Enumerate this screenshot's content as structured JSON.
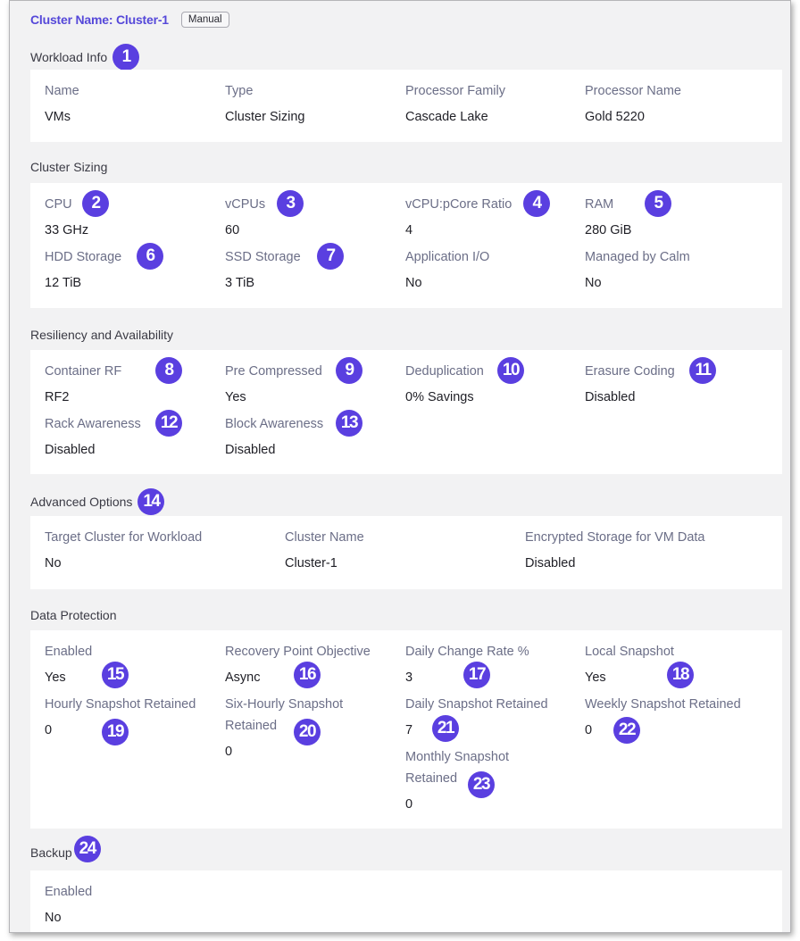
{
  "header": {
    "cluster_name": "Cluster Name: Cluster-1",
    "mode_button": "Manual"
  },
  "accent_color": "#5a3fe0",
  "sections": {
    "workload": {
      "title": "Workload Info",
      "badge": "1",
      "fields": [
        {
          "label": "Name",
          "value": "VMs"
        },
        {
          "label": "Type",
          "value": "Cluster Sizing"
        },
        {
          "label": "Processor Family",
          "value": "Cascade Lake"
        },
        {
          "label": "Processor Name",
          "value": "Gold 5220"
        }
      ]
    },
    "sizing": {
      "title": "Cluster Sizing",
      "fields": [
        {
          "label": "CPU",
          "value": "33 GHz",
          "badge": "2"
        },
        {
          "label": "vCPUs",
          "value": "60",
          "badge": "3"
        },
        {
          "label": "vCPU:pCore Ratio",
          "value": "4",
          "badge": "4"
        },
        {
          "label": "RAM",
          "value": "280 GiB",
          "badge": "5"
        },
        {
          "label": "HDD Storage",
          "value": "12 TiB",
          "badge": "6"
        },
        {
          "label": "SSD Storage",
          "value": "3 TiB",
          "badge": "7"
        },
        {
          "label": "Application I/O",
          "value": "No"
        },
        {
          "label": "Managed by Calm",
          "value": "No"
        }
      ]
    },
    "resiliency": {
      "title": "Resiliency and Availability",
      "fields": [
        {
          "label": "Container RF",
          "value": "RF2",
          "badge": "8"
        },
        {
          "label": "Pre Compressed",
          "value": "Yes",
          "badge": "9"
        },
        {
          "label": "Deduplication",
          "value": "0% Savings",
          "badge": "10"
        },
        {
          "label": "Erasure Coding",
          "value": "Disabled",
          "badge": "11"
        },
        {
          "label": "Rack Awareness",
          "value": "Disabled",
          "badge": "12"
        },
        {
          "label": "Block Awareness",
          "value": "Disabled",
          "badge": "13"
        }
      ]
    },
    "advanced": {
      "title": "Advanced Options",
      "badge": "14",
      "fields": [
        {
          "label": "Target Cluster for Workload",
          "value": "No"
        },
        {
          "label": "Cluster Name",
          "value": "Cluster-1"
        },
        {
          "label": "Encrypted Storage for VM Data",
          "value": "Disabled"
        }
      ]
    },
    "protection": {
      "title": "Data Protection",
      "fields": [
        {
          "label": "Enabled",
          "value": "Yes",
          "badge": "15"
        },
        {
          "label": "Recovery Point Objective",
          "value": "Async",
          "badge": "16"
        },
        {
          "label": "Daily Change Rate %",
          "value": "3",
          "badge": "17"
        },
        {
          "label": "Local Snapshot",
          "value": "Yes",
          "badge": "18"
        },
        {
          "label": "Hourly Snapshot Retained",
          "value": "0",
          "badge": "19"
        },
        {
          "label": "Six-Hourly Snapshot",
          "label2": "Retained",
          "value": "0",
          "badge": "20"
        },
        {
          "label": "Daily Snapshot Retained",
          "value": "7",
          "badge": "21"
        },
        {
          "label": "Weekly Snapshot Retained",
          "value": "0",
          "badge": "22"
        },
        {
          "label": "Monthly Snapshot",
          "label2": "Retained",
          "value": "0",
          "badge": "23"
        }
      ]
    },
    "backup": {
      "title": "Backup",
      "badge": "24",
      "fields": [
        {
          "label": "Enabled",
          "value": "No"
        }
      ]
    }
  }
}
